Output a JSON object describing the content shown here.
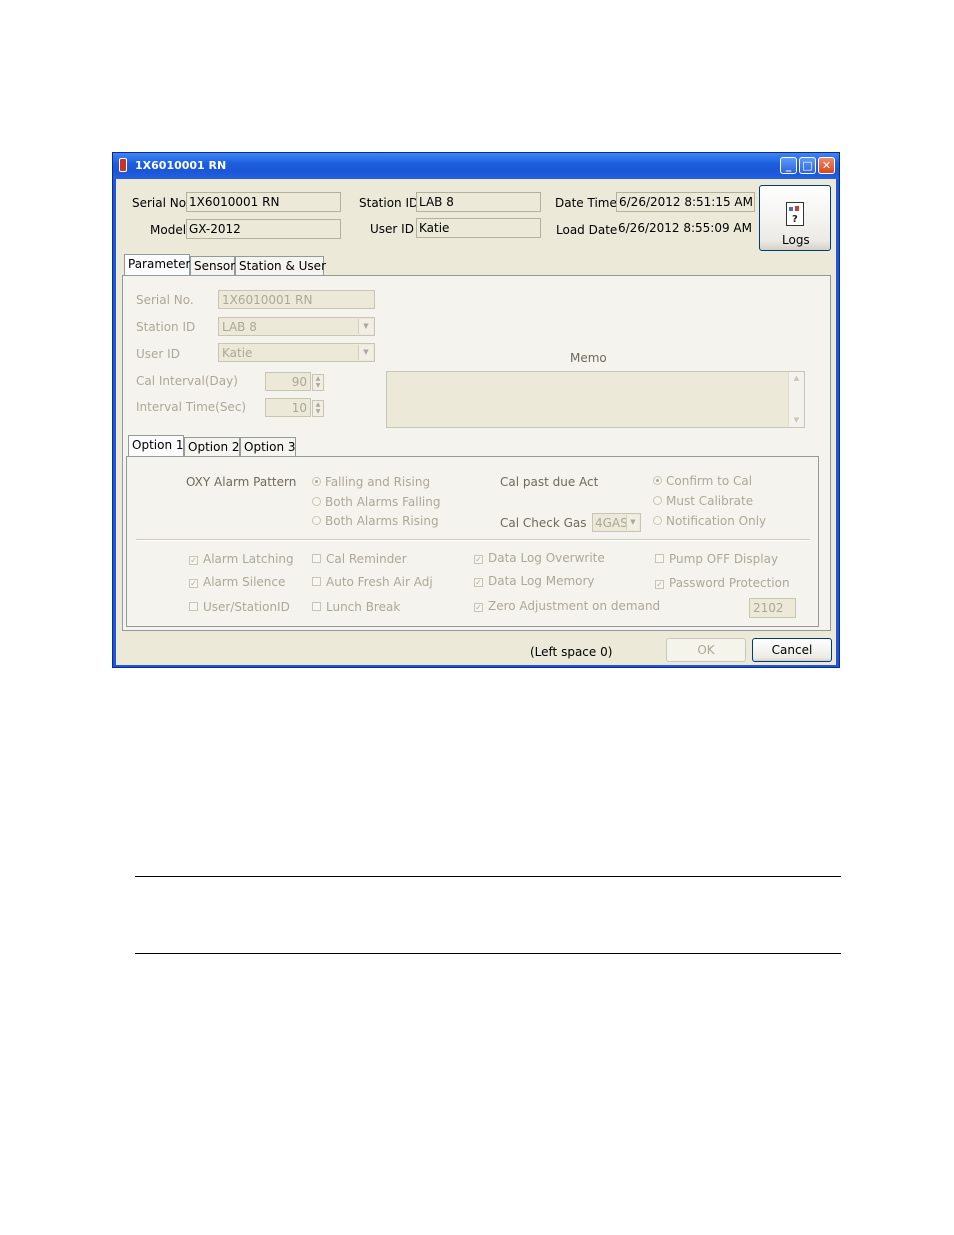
{
  "window": {
    "title": "1X6010001 RN",
    "minimize": "_",
    "maximize": "□",
    "close": "✕"
  },
  "header": {
    "serial_label": "Serial No.",
    "serial_value": "1X6010001 RN",
    "model_label": "Model",
    "model_value": "GX-2012",
    "station_label": "Station ID",
    "station_value": "LAB 8",
    "user_label": "User ID",
    "user_value": "Katie",
    "datetime_label": "Date Time",
    "datetime_value": "6/26/2012 8:51:15 AM",
    "loaddate_label": "Load Date",
    "loaddate_value": "6/26/2012 8:55:09 AM",
    "logs_label": "Logs"
  },
  "tabs": [
    "Parameter",
    "Sensor",
    "Station & User"
  ],
  "parameter": {
    "serial_label": "Serial No.",
    "serial_value": "1X6010001 RN",
    "station_label": "Station ID",
    "station_value": "LAB 8",
    "user_label": "User ID",
    "user_value": "Katie",
    "cal_interval_label": "Cal Interval(Day)",
    "cal_interval_value": "90",
    "interval_time_label": "Interval Time(Sec)",
    "interval_time_value": "10",
    "memo_label": "Memo"
  },
  "option_tabs": [
    "Option 1",
    "Option 2",
    "Option 3"
  ],
  "option1": {
    "oxy_label": "OXY Alarm Pattern",
    "oxy_options": [
      "Falling and Rising",
      "Both Alarms Falling",
      "Both Alarms Rising"
    ],
    "cal_past_label": "Cal past due Act",
    "cal_past_options": [
      "Confirm to Cal",
      "Must Calibrate",
      "Notification Only"
    ],
    "cal_check_label": "Cal Check Gas",
    "cal_check_value": "4GAS",
    "checks": {
      "alarm_latching": "Alarm Latching",
      "alarm_silence": "Alarm Silence",
      "user_station": "User/StationID",
      "cal_reminder": "Cal Reminder",
      "auto_fresh": "Auto Fresh Air Adj",
      "lunch_break": "Lunch Break",
      "data_log_overwrite": "Data Log Overwrite",
      "data_log_memory": "Data Log Memory",
      "zero_adjust": "Zero Adjustment on demand",
      "pump_off": "Pump OFF Display",
      "password": "Password Protection"
    },
    "password_value": "2102"
  },
  "footer": {
    "left_space": "(Left space 0)",
    "ok": "OK",
    "cancel": "Cancel"
  }
}
